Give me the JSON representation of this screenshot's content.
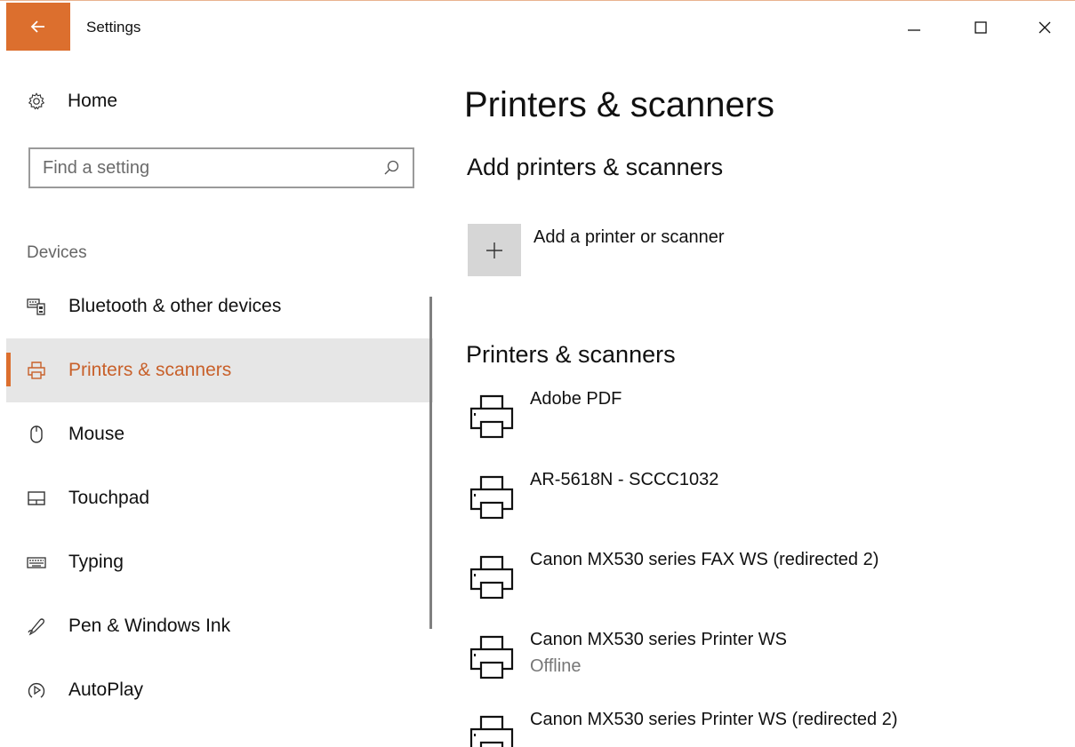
{
  "window": {
    "title": "Settings",
    "accent": "#dc6f2e"
  },
  "sidebar": {
    "home_label": "Home",
    "search_placeholder": "Find a setting",
    "section_label": "Devices",
    "items": [
      {
        "label": "Bluetooth & other devices",
        "icon": "bluetooth-devices-icon"
      },
      {
        "label": "Printers & scanners",
        "icon": "printer-icon",
        "active": true
      },
      {
        "label": "Mouse",
        "icon": "mouse-icon"
      },
      {
        "label": "Touchpad",
        "icon": "touchpad-icon"
      },
      {
        "label": "Typing",
        "icon": "keyboard-icon"
      },
      {
        "label": "Pen & Windows Ink",
        "icon": "pen-icon"
      },
      {
        "label": "AutoPlay",
        "icon": "autoplay-icon"
      }
    ]
  },
  "main": {
    "title": "Printers & scanners",
    "add_section_title": "Add printers & scanners",
    "add_label": "Add a printer or scanner",
    "list_section_title": "Printers & scanners",
    "printers": [
      {
        "name": "Adobe PDF",
        "status": ""
      },
      {
        "name": "AR-5618N - SCCC1032",
        "status": ""
      },
      {
        "name": "Canon MX530 series FAX WS (redirected 2)",
        "status": ""
      },
      {
        "name": "Canon MX530 series Printer WS",
        "status": "Offline"
      },
      {
        "name": "Canon MX530 series Printer WS (redirected 2)",
        "status": ""
      }
    ]
  }
}
